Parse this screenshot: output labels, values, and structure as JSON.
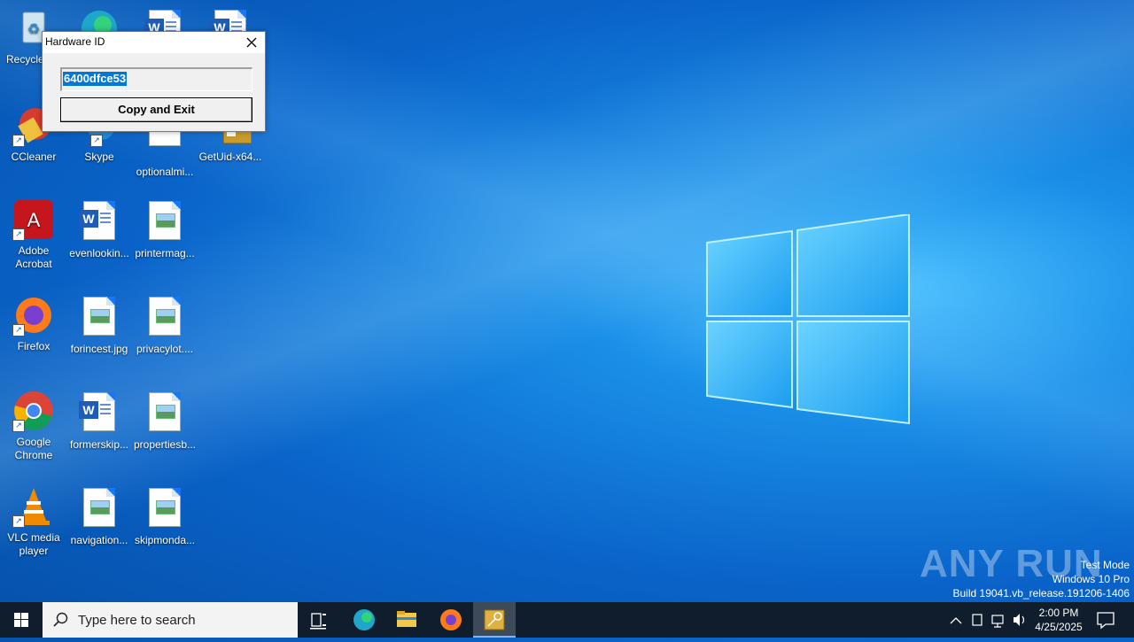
{
  "desktop": {
    "icons": [
      {
        "label": "Recycle Bin"
      },
      {
        "label": "Microsoft Edge"
      },
      {
        "label": ""
      },
      {
        "label": ""
      },
      {
        "label": "CCleaner"
      },
      {
        "label": "Skype"
      },
      {
        "label": "optionalmi..."
      },
      {
        "label": "GetUid-x64..."
      },
      {
        "label": "Adobe Acrobat"
      },
      {
        "label": "evenlookin..."
      },
      {
        "label": "printermag..."
      },
      {
        "label": "Firefox"
      },
      {
        "label": "forincest.jpg"
      },
      {
        "label": "privacylot...."
      },
      {
        "label": "Google Chrome"
      },
      {
        "label": "formerskip..."
      },
      {
        "label": "propertiesb..."
      },
      {
        "label": "VLC media player"
      },
      {
        "label": "navigation..."
      },
      {
        "label": "skipmonda..."
      }
    ]
  },
  "dialog": {
    "title": "Hardware ID",
    "hardware_id": "6400dfce53",
    "button_label": "Copy and Exit"
  },
  "watermark": {
    "brand": "ANY RUN",
    "mode": "Test Mode",
    "os": "Windows 10 Pro",
    "build": "Build 19041.vb_release.191206-1406"
  },
  "taskbar": {
    "search_placeholder": "Type here to search",
    "time": "2:00 PM",
    "date": "4/25/2025"
  },
  "colors": {
    "accent": "#0078d7",
    "taskbar": "#101d2c"
  }
}
